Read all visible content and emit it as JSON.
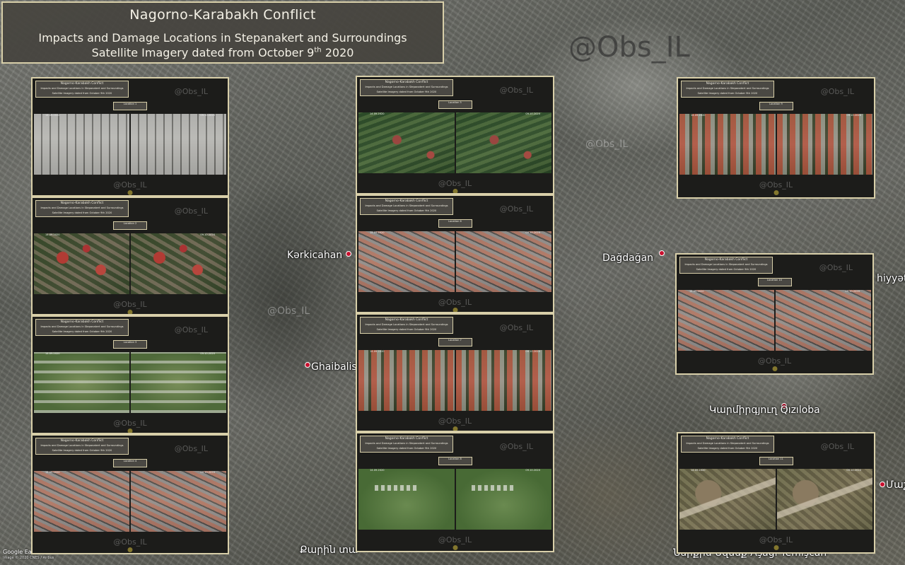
{
  "header": {
    "title": "Nagorno-Karabakh Conflict",
    "subtitle": "Impacts and Damage Locations in Stepanakert and Surroundings",
    "date_line_prefix": "Satellite Imagery dated from October 9",
    "date_line_sup": "th",
    "date_line_suffix": " 2020"
  },
  "watermark": {
    "main": "@Obs_IL",
    "small": "@Obs_IL"
  },
  "places": {
    "kerkicahan": "Kərkicahan",
    "dagdagan": "Dağdağan",
    "ghaibalis": "Ghaibalis",
    "qiziloba": "Կարմիրգյուղ Qızıloba",
    "qaribi": "Քարին տա",
    "nerkin": "Ներքին Սզնեք Aşağı Yemişcan",
    "mashk": "Մաշ",
    "hiyyet": "hiyyət"
  },
  "map_credit": {
    "logo": "Google Earth",
    "small": "Image © 2020 CNES / Airbus"
  },
  "panel_common": {
    "mini_title": "Nagorno-Karabakh Conflict",
    "mini_sub1": "Impacts and Damage Locations in Stepanakert and Surroundings",
    "mini_sub2": "Satellite Imagery dated from October 9th 2020",
    "watermark": "@Obs_IL"
  },
  "panels": [
    {
      "location": "Location 1",
      "date_before": "14.09.2020",
      "date_after": "09.10.2020"
    },
    {
      "location": "Location 2",
      "date_before": "14.09.2020",
      "date_after": "09.10.2020"
    },
    {
      "location": "Location 3",
      "date_before": "14.09.2020",
      "date_after": "09.10.2020"
    },
    {
      "location": "Location 4",
      "date_before": "14.09.2020",
      "date_after": "09.10.2020"
    },
    {
      "location": "Location 5",
      "date_before": "14.09.2020",
      "date_after": "09.10.2020"
    },
    {
      "location": "Location 6",
      "date_before": "14.09.2020",
      "date_after": "09.10.2020"
    },
    {
      "location": "Location 7",
      "date_before": "14.09.2020",
      "date_after": "09.10.2020"
    },
    {
      "location": "Location 8",
      "date_before": "14.09.2020",
      "date_after": "09.10.2020"
    },
    {
      "location": "Location 9",
      "date_before": "14.09.2020",
      "date_after": "09.10.2020"
    },
    {
      "location": "Location 10",
      "date_before": "14.09.2020",
      "date_after": "09.10.2020"
    },
    {
      "location": "Location 11",
      "date_before": "14.09.2020",
      "date_after": "09.10.2020"
    }
  ]
}
